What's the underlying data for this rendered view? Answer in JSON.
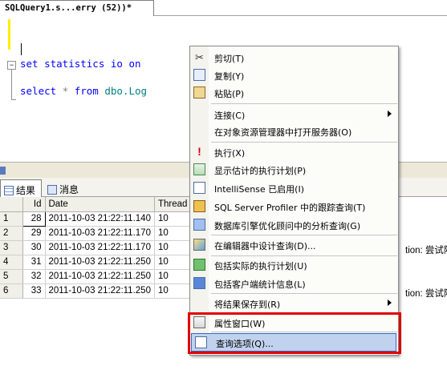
{
  "document_tab": {
    "title": "SQLQuery1.s...erry (52))*"
  },
  "editor": {
    "line1": {
      "keyword": "set",
      "middle": " statistics io ",
      "keyword2": "on"
    },
    "line2": {
      "keyword": "select",
      "middle": " * ",
      "keyword2": "from",
      "object": " dbo.Log"
    }
  },
  "results": {
    "tabs": [
      {
        "label": "结果",
        "icon": "grid-icon",
        "active": true
      },
      {
        "label": "消息",
        "icon": "message-icon",
        "active": false
      }
    ],
    "columns": [
      "Id",
      "Date",
      "Thread"
    ],
    "rows": [
      {
        "num": "1",
        "id": "28",
        "date": "2011-10-03 21:22:11.140",
        "thread": "10",
        "extra": ""
      },
      {
        "num": "2",
        "id": "29",
        "date": "2011-10-03 21:22:11.170",
        "thread": "10",
        "extra": ""
      },
      {
        "num": "3",
        "id": "30",
        "date": "2011-10-03 21:22:11.170",
        "thread": "10",
        "extra": "tion: 尝试除以"
      },
      {
        "num": "4",
        "id": "31",
        "date": "2011-10-03 21:22:11.250",
        "thread": "10",
        "extra": ""
      },
      {
        "num": "5",
        "id": "32",
        "date": "2011-10-03 21:22:11.250",
        "thread": "10",
        "extra": ""
      },
      {
        "num": "6",
        "id": "33",
        "date": "2011-10-03 21:22:11.250",
        "thread": "10",
        "extra": "tion: 尝试除以"
      }
    ]
  },
  "context_menu": {
    "items": [
      {
        "label": "剪切(T)",
        "icon": "scissors-icon"
      },
      {
        "label": "复制(Y)",
        "icon": "copy-icon"
      },
      {
        "label": "粘贴(P)",
        "icon": "paste-icon"
      },
      {
        "label": "连接(C)",
        "icon": "",
        "submenu": true
      },
      {
        "label": "在对象资源管理器中打开服务器(O)",
        "icon": ""
      },
      {
        "label": "执行(X)",
        "icon": "execute-icon"
      },
      {
        "label": "显示估计的执行计划(P)",
        "icon": "estimated-plan-icon"
      },
      {
        "label": "IntelliSense 已启用(I)",
        "icon": "intellisense-icon"
      },
      {
        "label": "SQL Server Profiler 中的跟踪查询(T)",
        "icon": "profiler-icon"
      },
      {
        "label": "数据库引擎优化顾问中的分析查询(G)",
        "icon": "tuning-advisor-icon"
      },
      {
        "label": "在编辑器中设计查询(D)...",
        "icon": "query-designer-icon"
      },
      {
        "label": "包括实际的执行计划(U)",
        "icon": "actual-plan-icon"
      },
      {
        "label": "包括客户端统计信息(L)",
        "icon": "client-stats-icon"
      },
      {
        "label": "将结果保存到(R)",
        "icon": "",
        "submenu": true
      },
      {
        "label": "属性窗口(W)",
        "icon": "properties-icon"
      },
      {
        "label": "查询选项(Q)...",
        "icon": "query-options-icon"
      }
    ]
  },
  "colors": {
    "highlight_border": "#e00000",
    "keyword": "#0000ff",
    "object": "#008080",
    "menu_hover": "#c1d2ee"
  }
}
